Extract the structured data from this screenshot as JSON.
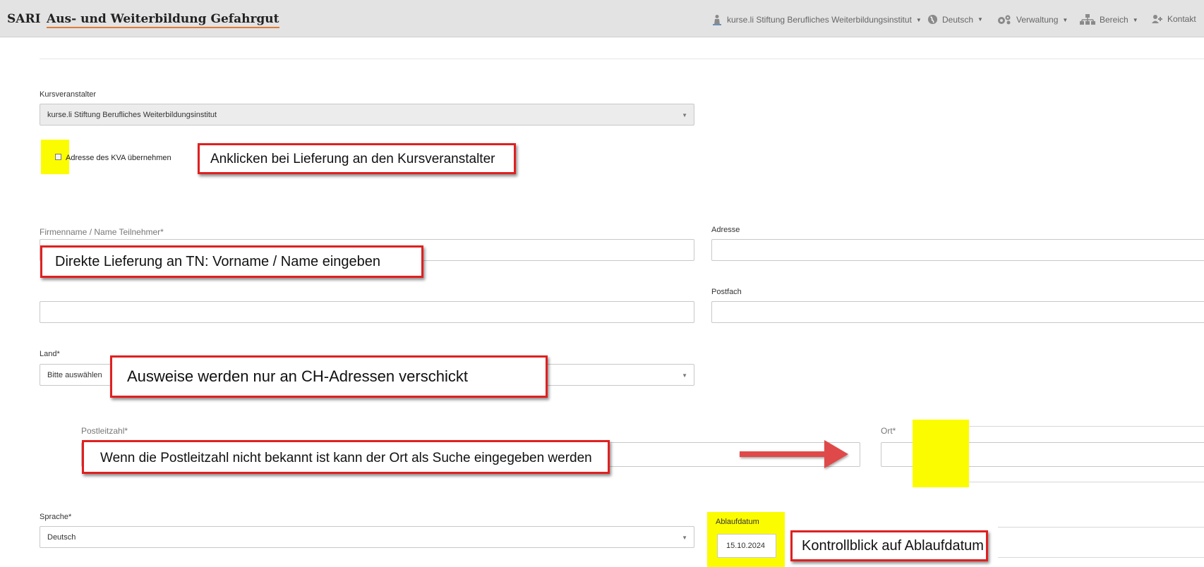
{
  "header": {
    "brand": "SARI",
    "title": "Aus- und Weiterbildung Gefahrgut",
    "nav": {
      "organization": "kurse.li Stiftung Berufliches Weiterbildungsinstitut",
      "language": "Deutsch",
      "admin": "Verwaltung",
      "area": "Bereich",
      "contact": "Kontakt"
    }
  },
  "form": {
    "kursveranstalter_label": "Kursveranstalter",
    "kursveranstalter_value": "kurse.li Stiftung Berufliches Weiterbildungsinstitut",
    "kva_checkbox_label": "Adresse des KVA übernehmen",
    "firmenname_label": "Firmenname / Name Teilnehmer*",
    "adresse_label": "Adresse",
    "postfach_label": "Postfach",
    "land_label": "Land*",
    "land_value": "Bitte auswählen",
    "plz_label": "Postleitzahl*",
    "ort_label": "Ort*",
    "sprache_label": "Sprache*",
    "sprache_value": "Deutsch",
    "ablaufdatum_label": "Ablaufdatum",
    "ablaufdatum_value": "15.10.2024"
  },
  "annotations": {
    "kva": "Anklicken bei Lieferung an den Kursveranstalter",
    "name": "Direkte Lieferung an TN: Vorname / Name eingeben",
    "land": "Ausweise werden nur an CH-Adressen verschickt",
    "plz": "Wenn die Postleitzahl nicht bekannt ist kann der Ort als Suche eingegeben werden",
    "ablauf": "Kontrollblick auf Ablaufdatum"
  },
  "colors": {
    "highlight": "#fcfc00",
    "callout_border": "#e02020",
    "arrow": "#e04848",
    "brand_underline": "#e07b39"
  }
}
